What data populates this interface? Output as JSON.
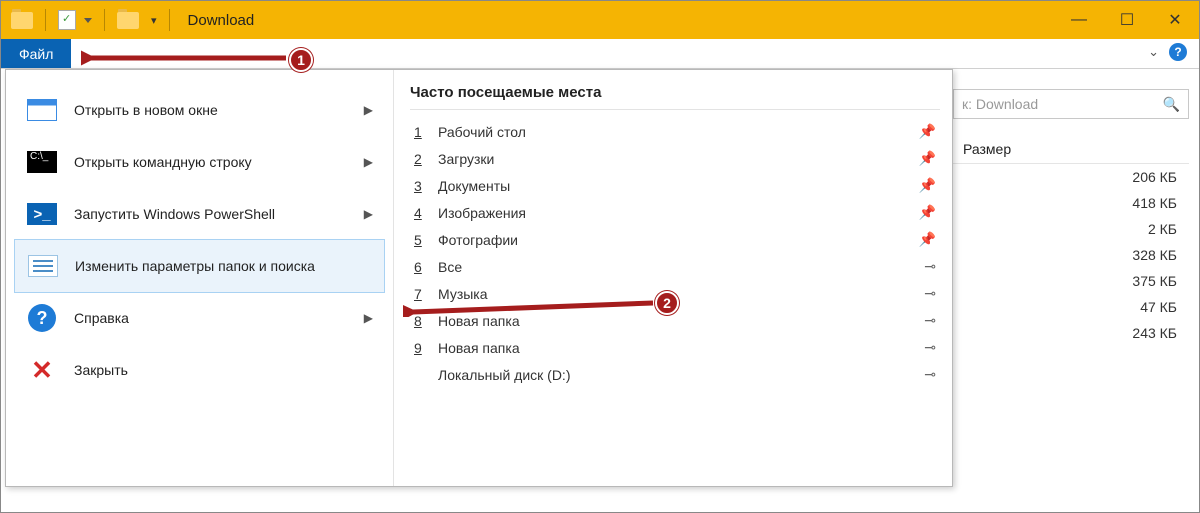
{
  "titlebar": {
    "title": "Download"
  },
  "win_controls": {
    "minimize": "—",
    "maximize": "☐",
    "close": "✕"
  },
  "ribbon": {
    "file_tab": "Файл",
    "help_tip": "?"
  },
  "search": {
    "placeholder": "к: Download"
  },
  "dropdown_left": {
    "items": [
      {
        "label": "Открыть в новом окне",
        "icon": "window",
        "has_submenu": true,
        "highlight": false
      },
      {
        "label": "Открыть командную строку",
        "icon": "cmd",
        "has_submenu": true,
        "highlight": false
      },
      {
        "label": "Запустить Windows PowerShell",
        "icon": "ps",
        "has_submenu": true,
        "highlight": false
      },
      {
        "label": "Изменить параметры папок и поиска",
        "icon": "opts",
        "has_submenu": false,
        "highlight": true
      },
      {
        "label": "Справка",
        "icon": "help",
        "has_submenu": true,
        "highlight": false
      },
      {
        "label": "Закрыть",
        "icon": "close",
        "has_submenu": false,
        "highlight": false
      }
    ]
  },
  "dropdown_right": {
    "heading": "Часто посещаемые места",
    "items": [
      {
        "num": "1",
        "label": "Рабочий стол",
        "pin": "pinned"
      },
      {
        "num": "2",
        "label": "Загрузки",
        "pin": "pinned"
      },
      {
        "num": "3",
        "label": "Документы",
        "pin": "pinned"
      },
      {
        "num": "4",
        "label": "Изображения",
        "pin": "pinned"
      },
      {
        "num": "5",
        "label": "Фотографии",
        "pin": "pinned"
      },
      {
        "num": "6",
        "label": "Все",
        "pin": "unpinned"
      },
      {
        "num": "7",
        "label": "Музыка",
        "pin": "unpinned"
      },
      {
        "num": "8",
        "label": "Новая папка",
        "pin": "unpinned"
      },
      {
        "num": "9",
        "label": "Новая папка",
        "pin": "unpinned"
      },
      {
        "num": "",
        "label": "Локальный диск (D:)",
        "pin": "unpinned"
      }
    ]
  },
  "behind": {
    "col_header": "Размер",
    "sizes": [
      "206 КБ",
      "418 КБ",
      "2 КБ",
      "328 КБ",
      "375 КБ",
      "47 КБ",
      "243 КБ"
    ]
  },
  "annotations": {
    "badge1": "1",
    "badge2": "2"
  }
}
